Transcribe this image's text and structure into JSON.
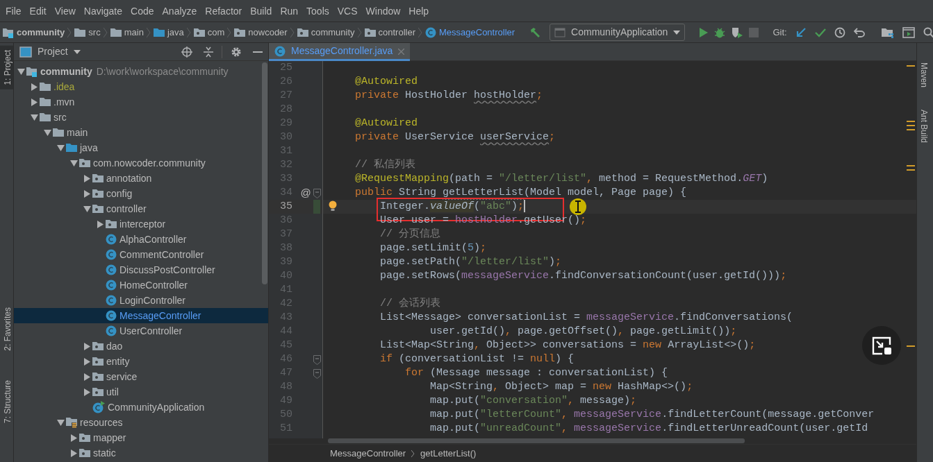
{
  "menu": [
    "File",
    "Edit",
    "View",
    "Navigate",
    "Code",
    "Analyze",
    "Refactor",
    "Build",
    "Run",
    "Tools",
    "VCS",
    "Window",
    "Help"
  ],
  "nav_path": [
    {
      "label": "community",
      "kind": "module"
    },
    {
      "label": "src",
      "kind": "folder"
    },
    {
      "label": "main",
      "kind": "folder"
    },
    {
      "label": "java",
      "kind": "source"
    },
    {
      "label": "com",
      "kind": "package"
    },
    {
      "label": "nowcoder",
      "kind": "package"
    },
    {
      "label": "community",
      "kind": "package"
    },
    {
      "label": "controller",
      "kind": "package"
    },
    {
      "label": "MessageController",
      "kind": "class"
    }
  ],
  "toolbar": {
    "run_config": "CommunityApplication",
    "vcs_label": "Git:",
    "stop_disabled": true
  },
  "side_tabs_left": [
    {
      "label": "1: Project",
      "selected": true
    },
    {
      "label": "2: Favorites",
      "selected": false
    },
    {
      "label": "7: Structure",
      "selected": false
    }
  ],
  "side_tabs_right": [
    {
      "label": "Maven"
    },
    {
      "label": "Ant Build"
    }
  ],
  "project_panel": {
    "title": "Project"
  },
  "project_tree": [
    {
      "label": "community",
      "path": "D:\\work\\workspace\\community",
      "kind": "module",
      "expanded": true,
      "selected": false,
      "children": [
        {
          "label": ".idea",
          "kind": "ignored-folder",
          "expanded": false,
          "selected": false
        },
        {
          "label": ".mvn",
          "kind": "folder",
          "expanded": false,
          "selected": false
        },
        {
          "label": "src",
          "kind": "folder",
          "expanded": true,
          "selected": false,
          "children": [
            {
              "label": "main",
              "kind": "folder",
              "expanded": true,
              "selected": false,
              "children": [
                {
                  "label": "java",
                  "kind": "source",
                  "expanded": true,
                  "selected": false,
                  "children": [
                    {
                      "label": "com.nowcoder.community",
                      "kind": "package",
                      "expanded": true,
                      "selected": false,
                      "children": [
                        {
                          "label": "annotation",
                          "kind": "package",
                          "expanded": false,
                          "selected": false
                        },
                        {
                          "label": "config",
                          "kind": "package",
                          "expanded": false,
                          "selected": false
                        },
                        {
                          "label": "controller",
                          "kind": "package",
                          "expanded": true,
                          "selected": false,
                          "children": [
                            {
                              "label": "interceptor",
                              "kind": "package",
                              "expanded": false,
                              "selected": false
                            },
                            {
                              "label": "AlphaController",
                              "kind": "class",
                              "selected": false
                            },
                            {
                              "label": "CommentController",
                              "kind": "class",
                              "selected": false
                            },
                            {
                              "label": "DiscussPostController",
                              "kind": "class",
                              "selected": false
                            },
                            {
                              "label": "HomeController",
                              "kind": "class",
                              "selected": false
                            },
                            {
                              "label": "LoginController",
                              "kind": "class",
                              "selected": false
                            },
                            {
                              "label": "MessageController",
                              "kind": "class",
                              "selected": true
                            },
                            {
                              "label": "UserController",
                              "kind": "class",
                              "selected": false
                            }
                          ]
                        },
                        {
                          "label": "dao",
                          "kind": "package",
                          "expanded": false,
                          "selected": false
                        },
                        {
                          "label": "entity",
                          "kind": "package",
                          "expanded": false,
                          "selected": false
                        },
                        {
                          "label": "service",
                          "kind": "package",
                          "expanded": false,
                          "selected": false
                        },
                        {
                          "label": "util",
                          "kind": "package",
                          "expanded": false,
                          "selected": false
                        },
                        {
                          "label": "CommunityApplication",
                          "kind": "app-class",
                          "selected": false
                        }
                      ]
                    }
                  ]
                },
                {
                  "label": "resources",
                  "kind": "resources",
                  "expanded": true,
                  "selected": false,
                  "children": [
                    {
                      "label": "mapper",
                      "kind": "package",
                      "expanded": false,
                      "selected": false
                    },
                    {
                      "label": "static",
                      "kind": "package",
                      "expanded": false,
                      "selected": false
                    }
                  ]
                }
              ]
            }
          ]
        }
      ]
    }
  ],
  "editor_tabs": [
    {
      "label": "MessageController.java",
      "selected": true
    }
  ],
  "code_lines": [
    {
      "number": "25",
      "current": false,
      "boxed": false
    },
    {
      "number": "26",
      "current": false,
      "boxed": false,
      "tokens": [
        {
          "kind": "annotation",
          "text": "    @Autowired"
        }
      ]
    },
    {
      "number": "27",
      "current": false,
      "boxed": false,
      "tokens": [
        {
          "kind": "keyword",
          "text": "    private "
        },
        {
          "kind": "plain",
          "text": "HostHolder "
        },
        {
          "kind": "unused",
          "text": "hostHolder"
        },
        {
          "kind": "keyword",
          "text": ";"
        }
      ]
    },
    {
      "number": "28",
      "current": false,
      "boxed": false
    },
    {
      "number": "29",
      "current": false,
      "boxed": false,
      "tokens": [
        {
          "kind": "annotation",
          "text": "    @Autowired"
        }
      ]
    },
    {
      "number": "30",
      "current": false,
      "boxed": false,
      "tokens": [
        {
          "kind": "keyword",
          "text": "    private "
        },
        {
          "kind": "plain",
          "text": "UserService "
        },
        {
          "kind": "unused",
          "text": "userService"
        },
        {
          "kind": "keyword",
          "text": ";"
        }
      ]
    },
    {
      "number": "31",
      "current": false,
      "boxed": false
    },
    {
      "number": "32",
      "current": false,
      "boxed": false,
      "tokens": [
        {
          "kind": "comment",
          "text": "    // 私信列表"
        }
      ]
    },
    {
      "number": "33",
      "current": false,
      "boxed": false,
      "tokens": [
        {
          "kind": "annotation",
          "text": "    @RequestMapping"
        },
        {
          "kind": "plain",
          "text": "(path = "
        },
        {
          "kind": "string",
          "text": "\"/letter/list\""
        },
        {
          "kind": "keyword",
          "text": ", "
        },
        {
          "kind": "plain",
          "text": "method = RequestMethod."
        },
        {
          "kind": "constant",
          "text": "GET"
        },
        {
          "kind": "plain",
          "text": ")"
        }
      ]
    },
    {
      "number": "34",
      "current": false,
      "boxed": false,
      "marker": "@",
      "gutter_icons": [
        {
          "kind": "fold"
        }
      ],
      "tokens": [
        {
          "kind": "keyword",
          "text": "    public "
        },
        {
          "kind": "plain",
          "text": "String "
        },
        {
          "kind": "unused",
          "text": "getLetterList"
        },
        {
          "kind": "plain",
          "text": "(Model model, Page page) {"
        }
      ]
    },
    {
      "number": "35",
      "current": true,
      "boxed": true,
      "gutter_icons": [
        {
          "kind": "changed"
        },
        {
          "kind": "bulb"
        }
      ],
      "tokens": [
        {
          "kind": "plain",
          "text": "        Integer."
        },
        {
          "kind": "highlighted",
          "text": "valueOf"
        },
        {
          "kind": "plain",
          "text": "("
        },
        {
          "kind": "string",
          "text": "\"abc\""
        },
        {
          "kind": "plain",
          "text": ")"
        },
        {
          "kind": "keyword",
          "text": ";"
        }
      ]
    },
    {
      "number": "36",
      "current": false,
      "boxed": false,
      "tokens": [
        {
          "kind": "plain",
          "text": "        User user = "
        },
        {
          "kind": "field",
          "text": "hostHolder"
        },
        {
          "kind": "plain",
          "text": ".getUser()"
        },
        {
          "kind": "keyword",
          "text": ";"
        }
      ]
    },
    {
      "number": "37",
      "current": false,
      "boxed": false,
      "tokens": [
        {
          "kind": "comment",
          "text": "        // 分页信息"
        }
      ]
    },
    {
      "number": "38",
      "current": false,
      "boxed": false,
      "tokens": [
        {
          "kind": "plain",
          "text": "        page.setLimit("
        },
        {
          "kind": "number",
          "text": "5"
        },
        {
          "kind": "plain",
          "text": ")"
        },
        {
          "kind": "keyword",
          "text": ";"
        }
      ]
    },
    {
      "number": "39",
      "current": false,
      "boxed": false,
      "tokens": [
        {
          "kind": "plain",
          "text": "        page.setPath("
        },
        {
          "kind": "string",
          "text": "\"/letter/list\""
        },
        {
          "kind": "plain",
          "text": ")"
        },
        {
          "kind": "keyword",
          "text": ";"
        }
      ]
    },
    {
      "number": "40",
      "current": false,
      "boxed": false,
      "tokens": [
        {
          "kind": "plain",
          "text": "        page.setRows("
        },
        {
          "kind": "field",
          "text": "messageService"
        },
        {
          "kind": "plain",
          "text": ".findConversationCount(user.getId()))"
        },
        {
          "kind": "keyword",
          "text": ";"
        }
      ]
    },
    {
      "number": "41",
      "current": false,
      "boxed": false
    },
    {
      "number": "42",
      "current": false,
      "boxed": false,
      "tokens": [
        {
          "kind": "comment",
          "text": "        // 会话列表"
        }
      ]
    },
    {
      "number": "43",
      "current": false,
      "boxed": false,
      "tokens": [
        {
          "kind": "plain",
          "text": "        List<Message> conversationList = "
        },
        {
          "kind": "field",
          "text": "messageService"
        },
        {
          "kind": "plain",
          "text": ".findConversations("
        }
      ]
    },
    {
      "number": "44",
      "current": false,
      "boxed": false,
      "tokens": [
        {
          "kind": "plain",
          "text": "                user.getId()"
        },
        {
          "kind": "keyword",
          "text": ", "
        },
        {
          "kind": "plain",
          "text": "page.getOffset()"
        },
        {
          "kind": "keyword",
          "text": ", "
        },
        {
          "kind": "plain",
          "text": "page.getLimit())"
        },
        {
          "kind": "keyword",
          "text": ";"
        }
      ]
    },
    {
      "number": "45",
      "current": false,
      "boxed": false,
      "tokens": [
        {
          "kind": "plain",
          "text": "        List<Map<String"
        },
        {
          "kind": "keyword",
          "text": ", "
        },
        {
          "kind": "plain",
          "text": "Object>> conversations = "
        },
        {
          "kind": "keyword",
          "text": "new "
        },
        {
          "kind": "plain",
          "text": "ArrayList<>()"
        },
        {
          "kind": "keyword",
          "text": ";"
        }
      ]
    },
    {
      "number": "46",
      "current": false,
      "boxed": false,
      "gutter_icons": [
        {
          "kind": "fold"
        }
      ],
      "tokens": [
        {
          "kind": "keyword",
          "text": "        if "
        },
        {
          "kind": "plain",
          "text": "(conversationList != "
        },
        {
          "kind": "keyword",
          "text": "null"
        },
        {
          "kind": "plain",
          "text": ") {"
        }
      ]
    },
    {
      "number": "47",
      "current": false,
      "boxed": false,
      "gutter_icons": [
        {
          "kind": "fold"
        }
      ],
      "tokens": [
        {
          "kind": "keyword",
          "text": "            for "
        },
        {
          "kind": "plain",
          "text": "(Message message : conversationList) {"
        }
      ]
    },
    {
      "number": "48",
      "current": false,
      "boxed": false,
      "tokens": [
        {
          "kind": "plain",
          "text": "                Map<String"
        },
        {
          "kind": "keyword",
          "text": ", "
        },
        {
          "kind": "plain",
          "text": "Object> map = "
        },
        {
          "kind": "keyword",
          "text": "new "
        },
        {
          "kind": "plain",
          "text": "HashMap<>()"
        },
        {
          "kind": "keyword",
          "text": ";"
        }
      ]
    },
    {
      "number": "49",
      "current": false,
      "boxed": false,
      "tokens": [
        {
          "kind": "plain",
          "text": "                map.put("
        },
        {
          "kind": "string",
          "text": "\"conversation\""
        },
        {
          "kind": "keyword",
          "text": ", "
        },
        {
          "kind": "plain",
          "text": "message)"
        },
        {
          "kind": "keyword",
          "text": ";"
        }
      ]
    },
    {
      "number": "50",
      "current": false,
      "boxed": false,
      "tokens": [
        {
          "kind": "plain",
          "text": "                map.put("
        },
        {
          "kind": "string",
          "text": "\"letterCount\""
        },
        {
          "kind": "keyword",
          "text": ", "
        },
        {
          "kind": "field",
          "text": "messageService"
        },
        {
          "kind": "plain",
          "text": ".findLetterCount(message.getConver"
        }
      ]
    },
    {
      "number": "51",
      "current": false,
      "boxed": false,
      "tokens": [
        {
          "kind": "plain",
          "text": "                map.put("
        },
        {
          "kind": "string",
          "text": "\"unreadCount\""
        },
        {
          "kind": "keyword",
          "text": ", "
        },
        {
          "kind": "field",
          "text": "messageService"
        },
        {
          "kind": "plain",
          "text": ".findLetterUnreadCount(user.getId"
        }
      ]
    }
  ],
  "editor_breadcrumb": [
    "MessageController",
    "getLetterList()"
  ]
}
